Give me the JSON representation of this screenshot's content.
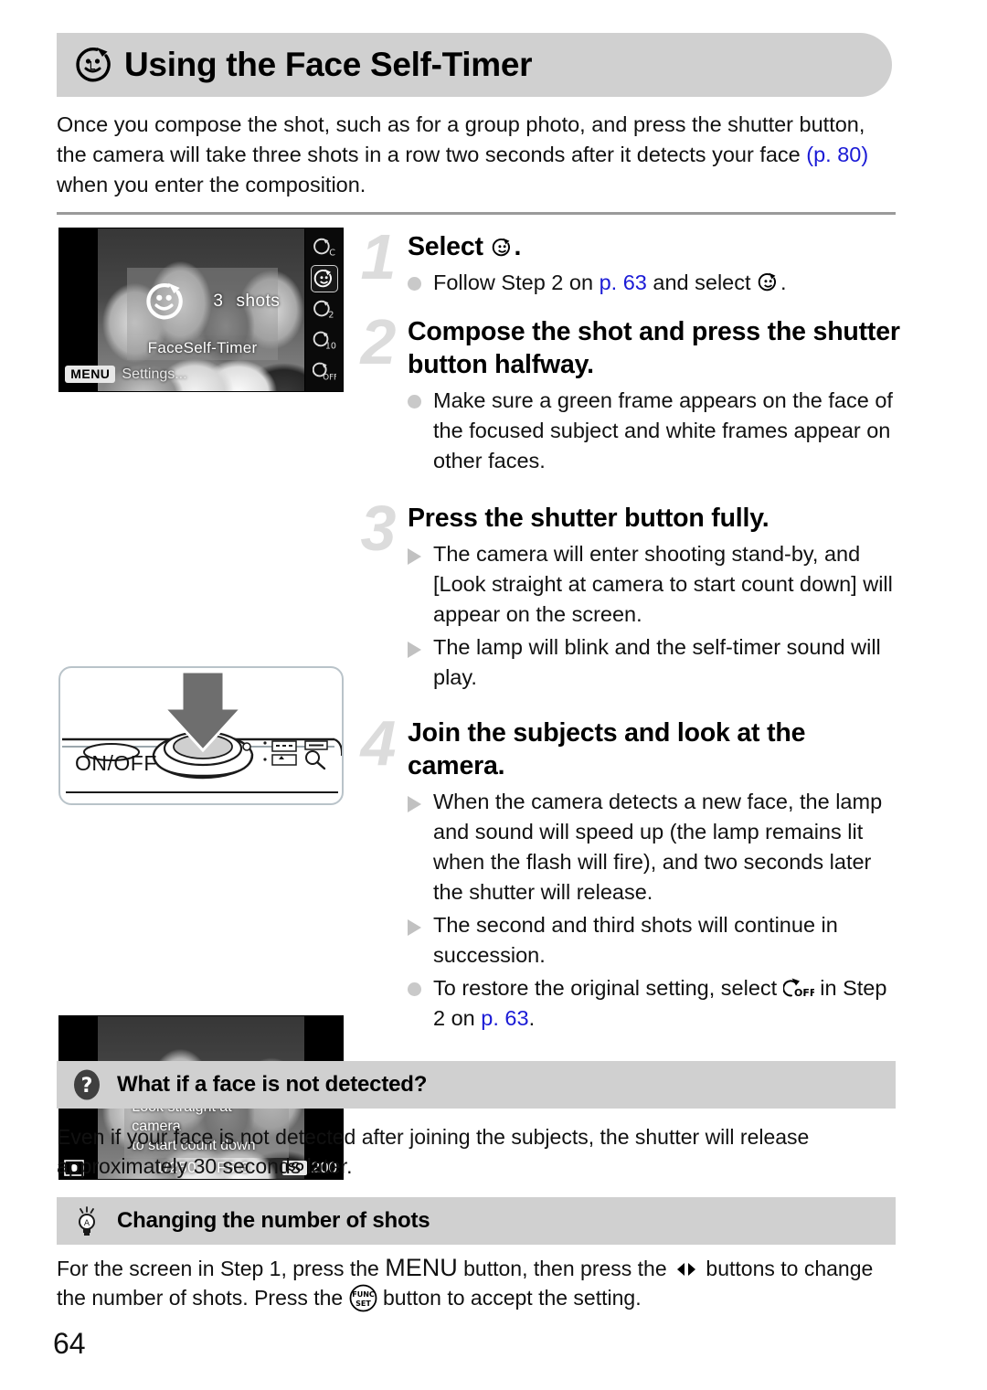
{
  "header": {
    "title": "Using the Face Self-Timer",
    "icon": "face-self-timer-icon",
    "bar_color": "#d0d0d0"
  },
  "intro": {
    "part1": "Once you compose the shot, such as for a group photo, and press the shutter button, the camera will take three shots in a row two seconds after it detects your face ",
    "link": "(p. 80)",
    "part2": " when you enter the composition.",
    "link_color": "#1b1bd6"
  },
  "figures": {
    "screen1": {
      "name": "face-self-timer-menu-screen",
      "shots_value": "3",
      "shots_label": "shots",
      "mode_label": "FaceSelf-Timer",
      "menu_chip": "MENU",
      "menu_text": "Settings...",
      "options": [
        "timer-custom-c",
        "timer-face",
        "timer-2sec",
        "timer-10sec",
        "timer-off"
      ],
      "selected_index": 1
    },
    "camera": {
      "name": "camera-top-shutter-illustration",
      "power_label": "ON/OFF"
    },
    "screen3": {
      "name": "look-straight-at-camera-screen",
      "message_line1": "Look straight at camera",
      "message_line2": "to start count down",
      "shutter_speed": "1/250",
      "aperture": "F5.6",
      "iso_chip": "ISO",
      "iso_value": "200"
    }
  },
  "steps": [
    {
      "number": "1",
      "heading_pre": "Select ",
      "heading_icon": "face-self-timer-icon",
      "heading_post": ".",
      "bullets": [
        {
          "marker": "dot",
          "pre": "Follow Step 2 on ",
          "link": "p. 63",
          "mid": " and select ",
          "icon": "face-self-timer-icon",
          "post": "."
        }
      ]
    },
    {
      "number": "2",
      "heading": "Compose the shot and press the shutter button halfway.",
      "bullets": [
        {
          "marker": "dot",
          "text": "Make sure a green frame appears on the face of the focused subject and white frames appear on other faces."
        }
      ]
    },
    {
      "number": "3",
      "heading": "Press the shutter button fully.",
      "bullets": [
        {
          "marker": "triangle",
          "text": "The camera will enter shooting stand-by, and [Look straight at camera to start count down] will appear on the screen."
        },
        {
          "marker": "triangle",
          "text": "The lamp will blink and the self-timer sound will play."
        }
      ]
    },
    {
      "number": "4",
      "heading": "Join the subjects and look at the camera.",
      "bullets": [
        {
          "marker": "triangle",
          "text": "When the camera detects a new face, the lamp and sound will speed up (the lamp remains lit when the flash will fire), and two seconds later the shutter will release."
        },
        {
          "marker": "triangle",
          "text": "The second and third shots will continue in succession."
        },
        {
          "marker": "dot",
          "pre": "To restore the original setting, select ",
          "icon": "timer-off-icon",
          "mid": " in Step 2 on ",
          "link": "p. 63",
          "post": "."
        }
      ]
    }
  ],
  "callouts": [
    {
      "icon": "question-mark-icon",
      "title": "What if a face is not detected?",
      "body": "Even if your face is not detected after joining the subjects, the shutter will release approximately 30 seconds later."
    },
    {
      "icon": "lightbulb-icon",
      "title": "Changing the number of shots",
      "body_pre": "For the screen in Step 1, press the ",
      "body_menu": "MENU",
      "body_mid": " button, then press the ",
      "body_icon1": "left-right-arrows-icon",
      "body_mid2": " buttons to change the number of shots. Press the ",
      "body_icon2": "func-set-icon",
      "body_post": " button to accept the setting."
    }
  ],
  "footer": {
    "page_number": "64"
  }
}
